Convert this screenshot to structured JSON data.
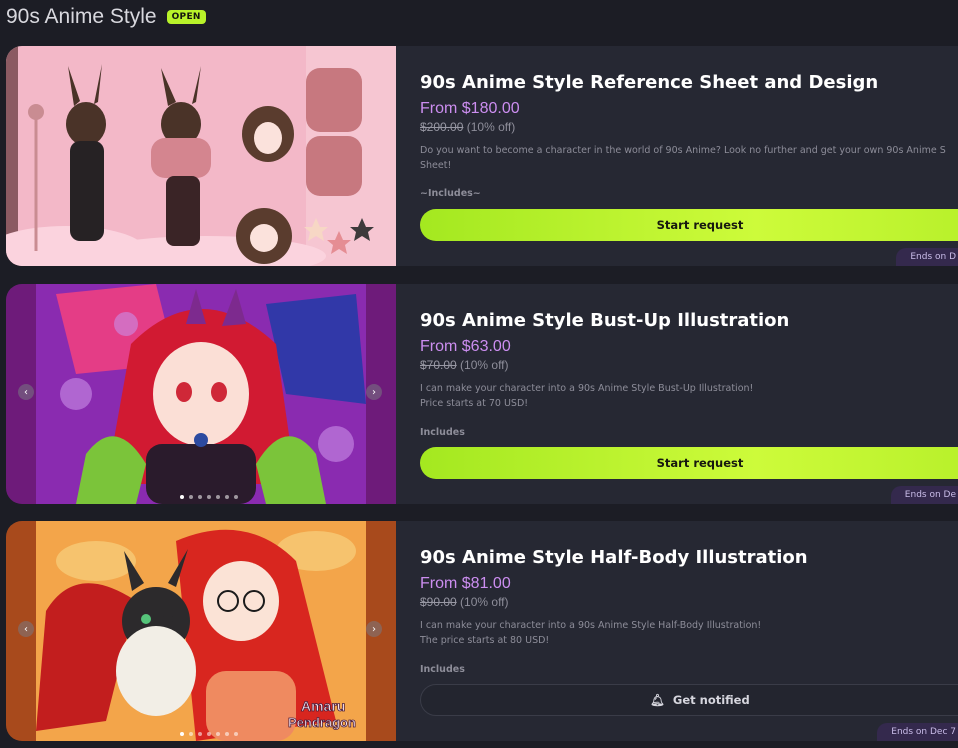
{
  "header": {
    "title": "90s Anime Style",
    "status_badge": "OPEN"
  },
  "cards": [
    {
      "title": "90s Anime Style Reference Sheet and Design",
      "price": "From $180.00",
      "old_price": "$200.00",
      "discount": "(10% off)",
      "description": [
        "Do you want to become a character in the world of 90s Anime? Look no further and get your own 90s Anime S",
        "Sheet!"
      ],
      "includes": "~Includes~",
      "action": "Start request",
      "ends": "Ends on D",
      "image_alt": "reference sheet artwork"
    },
    {
      "title": "90s Anime Style Bust-Up Illustration",
      "price": "From $63.00",
      "old_price": "$70.00",
      "discount": "(10% off)",
      "description": [
        "I can make your character into a 90s Anime Style Bust-Up Illustration!",
        "Price starts at 70 USD!"
      ],
      "includes": "Includes",
      "action": "Start request",
      "ends": "Ends on De",
      "image_alt": "bust-up illustration"
    },
    {
      "title": "90s Anime Style Half-Body Illustration",
      "price": "From $81.00",
      "old_price": "$90.00",
      "discount": "(10% off)",
      "description": [
        "I can make your character into a 90s Anime Style Half-Body Illustration!",
        "The price starts at 80 USD!"
      ],
      "includes": "Includes",
      "action": "Get notified",
      "ends": "Ends on Dec 7",
      "image_alt": "half-body illustration",
      "watermark": "Amatu Pendragon"
    }
  ],
  "colors": {
    "accent": "#c6f72f",
    "price": "#cc8ef0",
    "background": "#1c1d25",
    "card": "#262833",
    "ends_badge": "#34294d"
  },
  "icons": {
    "prev": "chevron-left-icon",
    "next": "chevron-right-icon",
    "bell": "bell-icon"
  }
}
